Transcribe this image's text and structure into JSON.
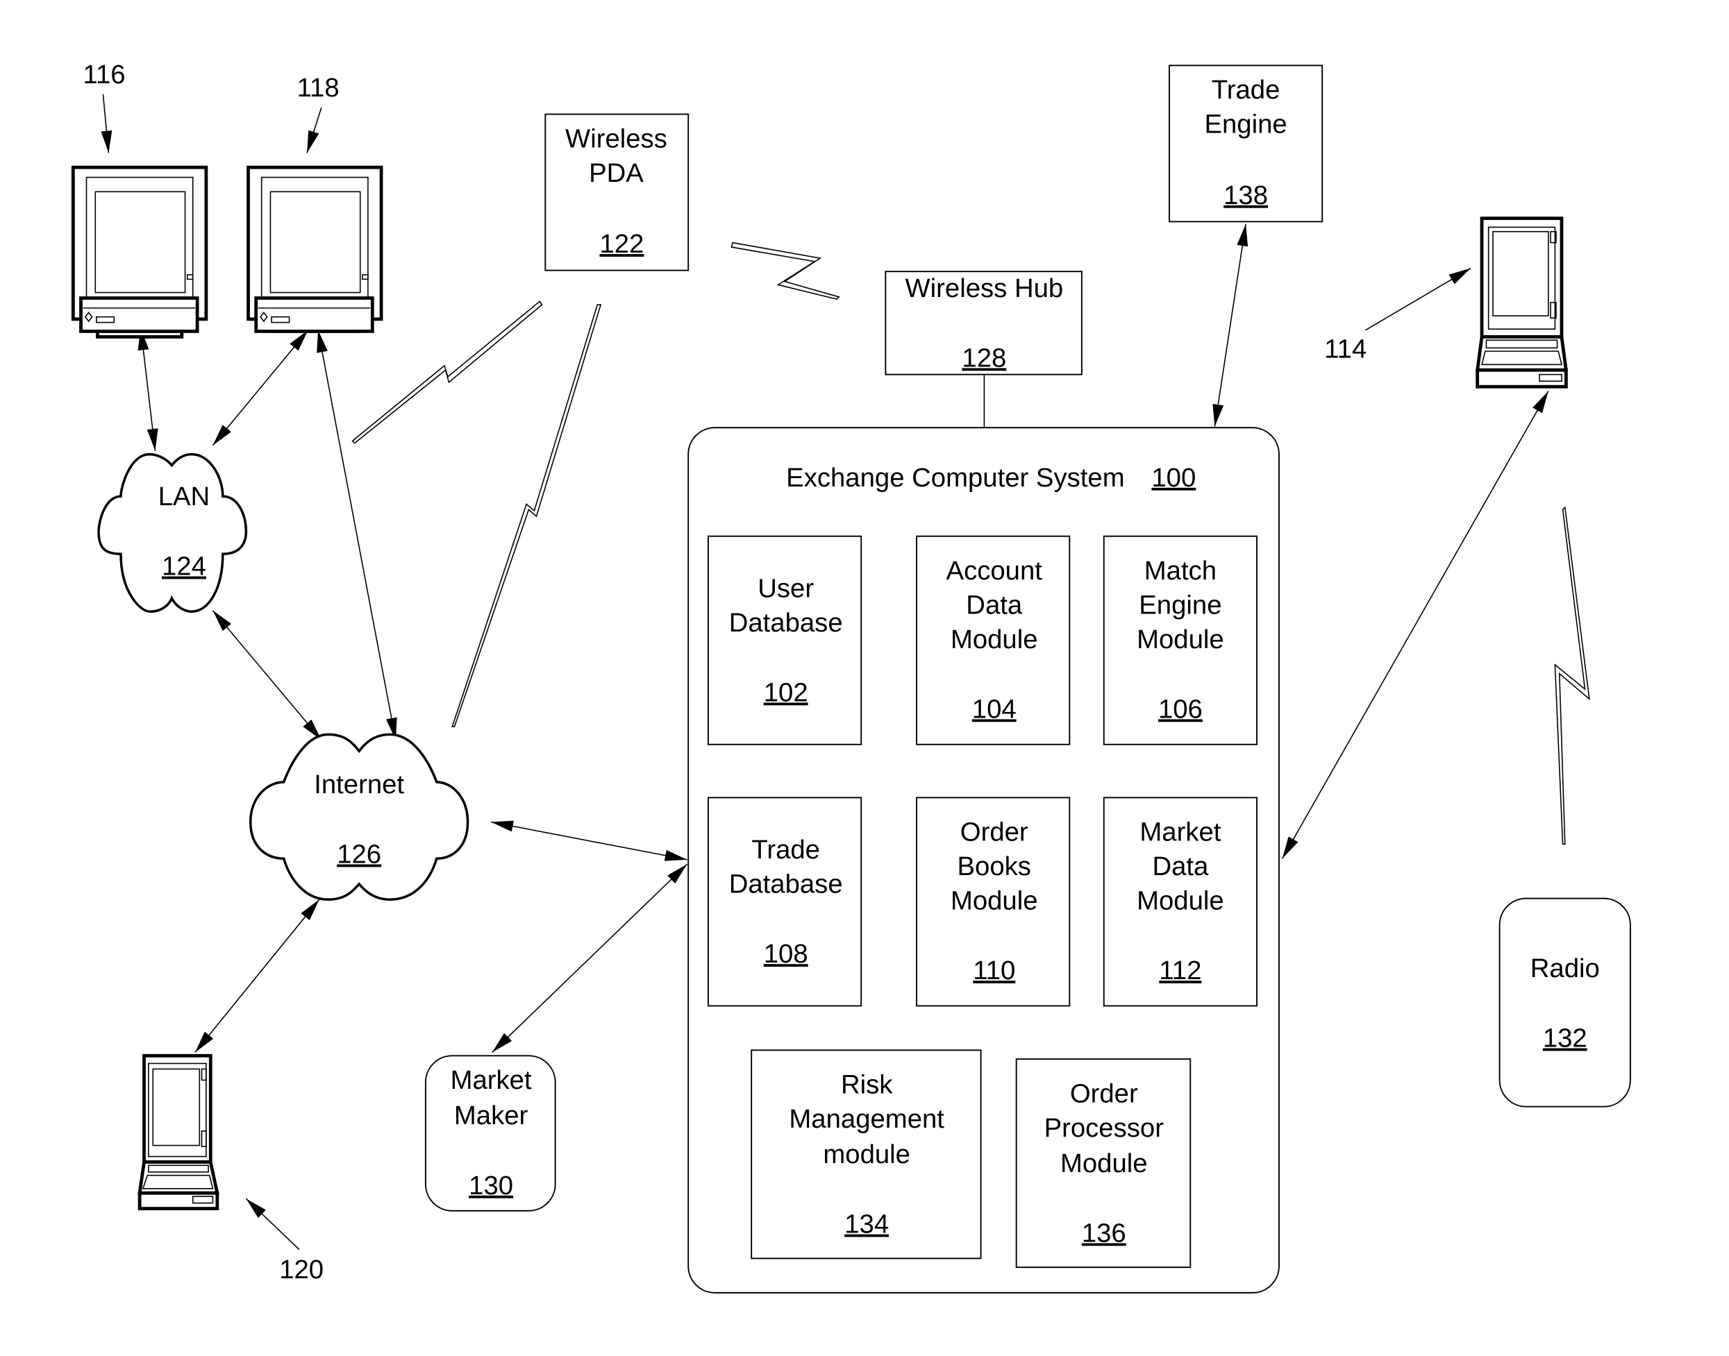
{
  "diagram": {
    "title": "Exchange Computer System",
    "title_ref": "100",
    "modules": [
      {
        "id": "user-database",
        "lines": [
          "User",
          "Database"
        ],
        "ref": "102"
      },
      {
        "id": "account-data-module",
        "lines": [
          "Account",
          "Data",
          "Module"
        ],
        "ref": "104"
      },
      {
        "id": "match-engine-module",
        "lines": [
          "Match",
          "Engine",
          "Module"
        ],
        "ref": "106"
      },
      {
        "id": "trade-database",
        "lines": [
          "Trade",
          "Database"
        ],
        "ref": "108"
      },
      {
        "id": "order-books-module",
        "lines": [
          "Order",
          "Books",
          "Module"
        ],
        "ref": "110"
      },
      {
        "id": "market-data-module",
        "lines": [
          "Market",
          "Data",
          "Module"
        ],
        "ref": "112"
      },
      {
        "id": "risk-management-module",
        "lines": [
          "Risk",
          "Management",
          "module"
        ],
        "ref": "134"
      },
      {
        "id": "order-processor-module",
        "lines": [
          "Order",
          "Processor",
          "Module"
        ],
        "ref": "136"
      }
    ],
    "external": {
      "wireless_pda": {
        "lines": [
          "Wireless",
          "PDA"
        ],
        "ref": "122"
      },
      "wireless_hub": {
        "lines": [
          "Wireless Hub"
        ],
        "ref": "128"
      },
      "trade_engine": {
        "lines": [
          "Trade",
          "Engine"
        ],
        "ref": "138"
      },
      "market_maker": {
        "lines": [
          "Market",
          "Maker"
        ],
        "ref": "130"
      },
      "radio": {
        "lines": [
          "Radio"
        ],
        "ref": "132"
      },
      "lan": {
        "lines": [
          "LAN"
        ],
        "ref": "124"
      },
      "internet": {
        "lines": [
          "Internet"
        ],
        "ref": "126"
      }
    },
    "device_refs": {
      "computer_1": "116",
      "computer_2": "118",
      "laptop_bottom": "120",
      "laptop_right": "114"
    }
  }
}
